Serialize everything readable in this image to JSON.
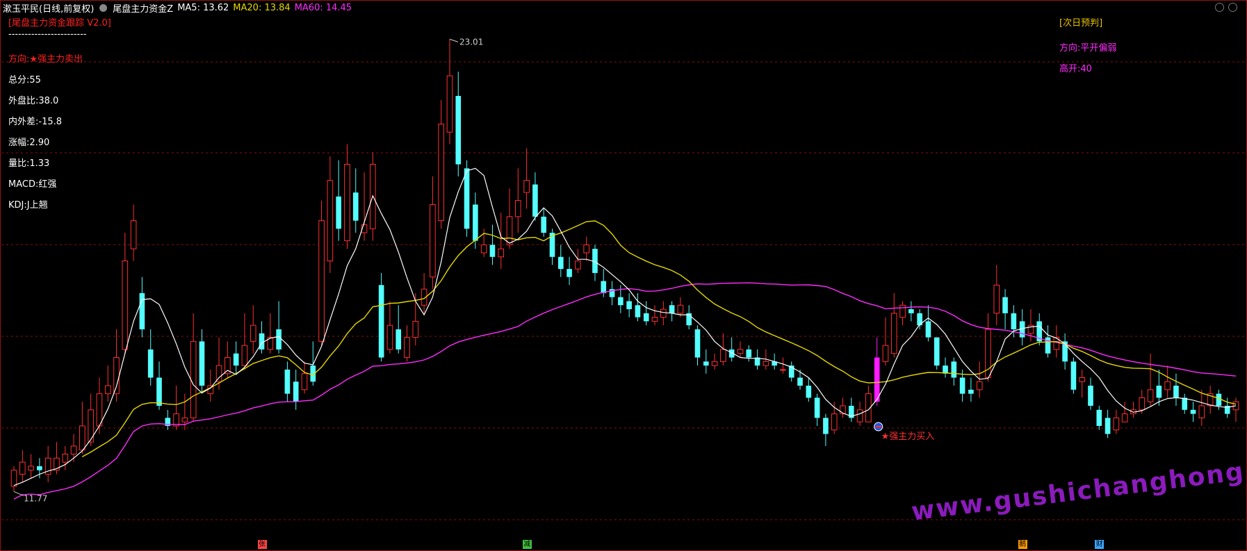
{
  "header": {
    "stock_name": "漱玉平民(日线,前复权)",
    "indicator_name": "尾盘主力资金Z",
    "ma": [
      {
        "label": "MA5: 13.62",
        "color": "#ffffff"
      },
      {
        "label": "MA20: 13.84",
        "color": "#e6d800"
      },
      {
        "label": "MA60: 14.45",
        "color": "#ff2cff"
      }
    ]
  },
  "left_panel": {
    "title": "[尾盘主力资金跟踪 V2.0]",
    "divider": "------------------------",
    "direction": "方向:★强主力卖出",
    "total": "总分:55",
    "outer_ratio": "外盘比:38.0",
    "inner_outer_diff": "内外差:-15.8",
    "change": "涨幅:2.90",
    "volume_ratio": "量比:1.33",
    "macd": "MACD:红强",
    "kdj": "KDJ:J上翘"
  },
  "right_panel": {
    "title": "[次日预判]",
    "direction": "方向:平开偏弱",
    "high_open": "高开:40"
  },
  "annotations": {
    "high_label": "23.01",
    "low_label": "11.77",
    "buy_signal": "★强主力买入"
  },
  "news_markers": [
    {
      "label": "张",
      "color": "#ff4444"
    },
    {
      "label": "减",
      "color": "#3fc03f"
    },
    {
      "label": "鹅",
      "color": "#ff9a00"
    },
    {
      "label": "财",
      "color": "#3aa7ff"
    }
  ],
  "watermark": "www.gushichanghong.com",
  "chart_data": {
    "type": "candlestick",
    "ylim": [
      11.0,
      23.5
    ],
    "colors": {
      "up": "#ff3030",
      "down": "#54ffff",
      "ma5": "#ffffff",
      "ma20": "#e6d800",
      "ma60": "#ff2cff",
      "signal_bar": "#ff1aff"
    },
    "candles": [
      [
        11.9,
        12.3,
        11.77,
        12.4
      ],
      [
        12.2,
        12.5,
        12.0,
        12.8
      ],
      [
        12.3,
        12.4,
        12.1,
        12.7
      ],
      [
        12.4,
        12.3,
        12.1,
        12.6
      ],
      [
        12.2,
        12.6,
        12.0,
        12.9
      ],
      [
        12.3,
        12.6,
        12.2,
        13.0
      ],
      [
        12.5,
        12.7,
        12.3,
        12.9
      ],
      [
        12.7,
        12.9,
        12.5,
        13.2
      ],
      [
        12.8,
        13.4,
        12.7,
        14.0
      ],
      [
        13.0,
        13.8,
        12.9,
        14.2
      ],
      [
        13.4,
        14.2,
        13.2,
        14.6
      ],
      [
        14.2,
        14.4,
        14.0,
        14.9
      ],
      [
        14.2,
        15.1,
        14.0,
        15.8
      ],
      [
        15.3,
        17.5,
        15.2,
        18.2
      ],
      [
        17.8,
        18.5,
        17.5,
        18.9
      ],
      [
        16.7,
        15.8,
        15.6,
        17.1
      ],
      [
        15.3,
        14.6,
        14.4,
        15.8
      ],
      [
        14.6,
        13.9,
        13.8,
        15.0
      ],
      [
        13.6,
        13.4,
        13.3,
        13.8
      ],
      [
        13.4,
        13.7,
        13.3,
        14.4
      ],
      [
        13.5,
        13.6,
        13.3,
        14.2
      ],
      [
        13.6,
        15.5,
        13.5,
        16.2
      ],
      [
        15.5,
        14.4,
        14.2,
        15.8
      ],
      [
        14.2,
        14.4,
        14.0,
        14.8
      ],
      [
        14.5,
        14.9,
        14.3,
        15.6
      ],
      [
        14.7,
        15.1,
        14.6,
        15.5
      ],
      [
        15.2,
        14.9,
        14.7,
        15.5
      ],
      [
        14.9,
        15.4,
        14.8,
        16.2
      ],
      [
        15.5,
        15.9,
        15.2,
        16.4
      ],
      [
        15.7,
        15.3,
        15.2,
        16.0
      ],
      [
        15.3,
        15.6,
        15.2,
        16.2
      ],
      [
        15.8,
        15.3,
        15.2,
        16.5
      ],
      [
        14.8,
        14.2,
        14.0,
        15.0
      ],
      [
        14.5,
        14.0,
        13.8,
        14.8
      ],
      [
        14.3,
        14.7,
        14.2,
        15.0
      ],
      [
        14.9,
        14.5,
        14.4,
        15.5
      ],
      [
        15.5,
        18.5,
        15.4,
        19.0
      ],
      [
        17.5,
        19.5,
        17.2,
        20.1
      ],
      [
        19.1,
        18.3,
        18.0,
        20.0
      ],
      [
        18.0,
        19.9,
        17.8,
        20.4
      ],
      [
        19.2,
        18.5,
        18.2,
        19.8
      ],
      [
        18.2,
        18.4,
        18.0,
        19.7
      ],
      [
        18.3,
        19.9,
        18.0,
        20.2
      ],
      [
        16.9,
        15.1,
        15.0,
        17.2
      ],
      [
        15.3,
        15.9,
        15.2,
        16.5
      ],
      [
        15.8,
        15.3,
        15.2,
        16.4
      ],
      [
        15.1,
        15.6,
        15.0,
        15.9
      ],
      [
        15.6,
        16.0,
        15.4,
        16.7
      ],
      [
        16.4,
        16.8,
        16.2,
        17.2
      ],
      [
        17.1,
        18.9,
        16.8,
        19.6
      ],
      [
        18.5,
        20.9,
        18.3,
        21.5
      ],
      [
        20.7,
        22.1,
        20.4,
        23.01
      ],
      [
        21.6,
        19.9,
        19.6,
        22.2
      ],
      [
        19.8,
        18.3,
        18.1,
        20.0
      ],
      [
        18.9,
        18.0,
        17.8,
        19.2
      ],
      [
        17.7,
        17.9,
        17.6,
        18.3
      ],
      [
        17.9,
        17.6,
        17.4,
        18.4
      ],
      [
        17.6,
        17.8,
        17.3,
        18.7
      ],
      [
        17.9,
        18.6,
        17.8,
        19.3
      ],
      [
        18.6,
        19.0,
        18.2,
        19.8
      ],
      [
        19.2,
        19.5,
        18.8,
        20.3
      ],
      [
        19.4,
        18.6,
        18.5,
        19.7
      ],
      [
        18.6,
        18.2,
        18.1,
        18.8
      ],
      [
        18.2,
        17.6,
        17.4,
        18.3
      ],
      [
        17.6,
        17.3,
        17.1,
        17.9
      ],
      [
        17.3,
        17.1,
        16.9,
        17.6
      ],
      [
        17.3,
        17.5,
        17.2,
        17.8
      ],
      [
        17.7,
        17.9,
        17.5,
        18.1
      ],
      [
        17.8,
        17.2,
        17.0,
        17.9
      ],
      [
        17.0,
        16.7,
        16.6,
        17.3
      ],
      [
        16.8,
        16.6,
        16.4,
        17.0
      ],
      [
        16.6,
        16.4,
        16.2,
        16.9
      ],
      [
        16.5,
        16.3,
        16.1,
        16.7
      ],
      [
        16.4,
        16.1,
        16.0,
        16.7
      ],
      [
        16.2,
        16.0,
        15.9,
        16.5
      ],
      [
        16.0,
        16.1,
        15.9,
        16.4
      ],
      [
        16.1,
        16.3,
        15.9,
        16.5
      ],
      [
        16.4,
        16.2,
        16.0,
        16.5
      ],
      [
        16.2,
        16.4,
        16.1,
        16.6
      ],
      [
        16.2,
        15.9,
        15.8,
        16.4
      ],
      [
        15.8,
        15.1,
        14.9,
        15.9
      ],
      [
        15.0,
        14.9,
        14.7,
        15.3
      ],
      [
        14.9,
        15.0,
        14.8,
        15.2
      ],
      [
        15.0,
        15.3,
        14.9,
        15.7
      ],
      [
        15.3,
        15.1,
        15.0,
        15.6
      ],
      [
        15.2,
        15.3,
        15.1,
        15.5
      ],
      [
        15.3,
        15.1,
        15.0,
        15.4
      ],
      [
        15.1,
        14.9,
        14.8,
        15.3
      ],
      [
        14.9,
        15.0,
        14.8,
        15.3
      ],
      [
        15.0,
        14.9,
        14.8,
        15.2
      ],
      [
        14.8,
        14.8,
        14.7,
        15.1
      ],
      [
        14.9,
        14.6,
        14.5,
        15.0
      ],
      [
        14.6,
        14.4,
        14.3,
        14.8
      ],
      [
        14.4,
        14.1,
        14.0,
        14.6
      ],
      [
        14.1,
        13.6,
        13.4,
        14.2
      ],
      [
        13.6,
        13.2,
        12.9,
        13.7
      ],
      [
        13.3,
        13.7,
        13.2,
        14.0
      ],
      [
        13.7,
        13.9,
        13.6,
        14.1
      ],
      [
        13.9,
        13.6,
        13.5,
        14.1
      ],
      [
        13.5,
        13.8,
        13.4,
        14.0
      ],
      [
        13.5,
        14.2,
        13.5,
        14.4
      ],
      [
        14.0,
        15.1,
        13.9,
        15.6
      ],
      [
        15.0,
        15.4,
        14.9,
        16.1
      ],
      [
        15.2,
        16.2,
        15.1,
        16.7
      ],
      [
        16.1,
        16.4,
        15.9,
        16.5
      ],
      [
        16.3,
        16.2,
        16.0,
        16.5
      ],
      [
        16.2,
        15.9,
        15.8,
        16.3
      ],
      [
        16.0,
        15.6,
        15.5,
        16.4
      ],
      [
        15.6,
        14.9,
        14.8,
        15.6
      ],
      [
        14.9,
        14.7,
        14.6,
        15.1
      ],
      [
        15.0,
        14.6,
        14.4,
        15.1
      ],
      [
        14.6,
        14.2,
        14.0,
        14.8
      ],
      [
        14.3,
        14.2,
        14.0,
        14.6
      ],
      [
        14.3,
        14.5,
        14.1,
        15.0
      ],
      [
        14.6,
        15.8,
        14.5,
        16.2
      ],
      [
        16.2,
        16.9,
        15.9,
        17.4
      ],
      [
        16.6,
        16.2,
        15.8,
        16.8
      ],
      [
        16.2,
        15.8,
        15.6,
        16.4
      ],
      [
        16.0,
        15.6,
        15.4,
        16.3
      ],
      [
        15.7,
        15.9,
        15.5,
        16.3
      ],
      [
        16.0,
        15.5,
        15.4,
        16.2
      ],
      [
        15.6,
        15.2,
        15.1,
        15.9
      ],
      [
        15.3,
        15.6,
        15.1,
        15.9
      ],
      [
        15.5,
        15.0,
        14.8,
        15.7
      ],
      [
        15.0,
        14.3,
        14.2,
        15.1
      ],
      [
        14.5,
        14.6,
        14.1,
        14.8
      ],
      [
        14.4,
        13.9,
        13.8,
        14.6
      ],
      [
        13.8,
        13.4,
        13.3,
        13.9
      ],
      [
        13.6,
        13.2,
        13.1,
        13.8
      ],
      [
        13.3,
        13.6,
        13.2,
        13.8
      ],
      [
        13.5,
        13.7,
        13.5,
        14.0
      ],
      [
        13.7,
        13.8,
        13.6,
        14.0
      ],
      [
        13.8,
        14.1,
        13.7,
        14.3
      ],
      [
        14.0,
        14.3,
        13.9,
        15.2
      ],
      [
        14.4,
        14.1,
        13.9,
        14.8
      ],
      [
        14.3,
        14.5,
        14.1,
        14.9
      ],
      [
        14.4,
        14.1,
        13.9,
        14.7
      ],
      [
        14.1,
        13.8,
        13.7,
        14.2
      ],
      [
        13.8,
        13.7,
        13.5,
        14.0
      ],
      [
        13.6,
        13.9,
        13.4,
        14.3
      ],
      [
        13.9,
        14.2,
        13.7,
        14.4
      ],
      [
        14.2,
        13.9,
        13.8,
        14.3
      ],
      [
        13.9,
        13.7,
        13.6,
        14.1
      ],
      [
        13.8,
        14.0,
        13.5,
        14.1
      ]
    ],
    "signal_index": 101,
    "ma5": [
      11.92,
      12.0,
      12.1,
      12.2,
      12.28,
      12.34,
      12.44,
      12.6,
      12.78,
      13.06,
      13.4,
      13.82,
      14.38,
      15.2,
      16.0,
      16.54,
      16.56,
      16.42,
      15.96,
      15.44,
      14.86,
      14.42,
      14.22,
      14.34,
      14.6,
      14.78,
      14.68,
      14.86,
      15.12,
      15.46,
      15.58,
      15.62,
      15.42,
      15.16,
      14.96,
      14.92,
      15.38,
      16.04,
      16.68,
      17.38,
      17.8,
      18.46,
      19.12,
      18.68,
      18.28,
      17.72,
      17.08,
      16.5,
      16.16,
      16.6,
      17.48,
      18.58,
      19.22,
      19.74,
      19.8,
      19.62,
      18.84,
      18.1,
      17.94,
      18.04,
      18.24,
      18.58,
      18.82,
      18.62,
      18.24,
      17.84,
      17.54,
      17.54,
      17.48,
      17.34,
      17.16,
      16.98,
      16.78,
      16.5,
      16.34,
      16.26,
      16.22,
      16.2,
      16.16,
      16.16,
      15.98,
      15.78,
      15.5,
      15.32,
      15.22,
      15.1,
      15.08,
      15.08,
      15.06,
      15.0,
      14.94,
      14.86,
      14.74,
      14.6,
      14.36,
      14.06,
      13.86,
      13.72,
      13.64,
      13.7,
      13.8,
      14.06,
      14.44,
      14.94,
      15.4,
      15.62,
      15.92,
      16.08,
      15.92,
      15.68,
      15.34,
      15.0,
      14.76,
      14.56,
      14.58,
      15.0,
      15.56,
      15.76,
      15.82,
      15.86,
      15.88,
      15.66,
      15.58,
      15.44,
      15.2,
      15.0,
      14.82,
      14.6,
      14.28,
      14.02,
      13.84,
      13.74,
      13.78,
      13.88,
      14.0,
      14.08,
      14.1,
      14.08,
      14.04,
      13.98,
      13.92,
      13.88,
      13.86,
      13.9
    ]
  }
}
